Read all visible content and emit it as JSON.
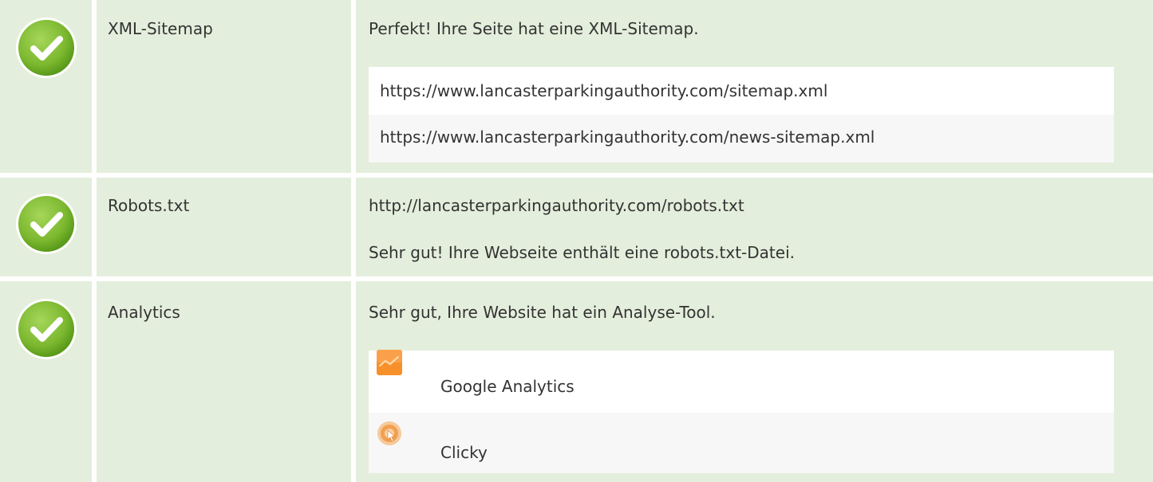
{
  "rows": [
    {
      "status": "pass",
      "label": "XML-Sitemap",
      "message": "Perfekt! Ihre Seite hat eine XML-Sitemap.",
      "urls": [
        "https://www.lancasterparkingauthority.com/sitemap.xml",
        "https://www.lancasterparkingauthority.com/news-sitemap.xml"
      ]
    },
    {
      "status": "pass",
      "label": "Robots.txt",
      "url": "http://lancasterparkingauthority.com/robots.txt",
      "message": "Sehr gut! Ihre Webseite enthält eine robots.txt-Datei."
    },
    {
      "status": "pass",
      "label": "Analytics",
      "message": "Sehr gut, Ihre Website hat ein Analyse-Tool.",
      "tools": [
        {
          "name": "Google Analytics",
          "icon": "google-analytics-icon"
        },
        {
          "name": "Clicky",
          "icon": "clicky-icon"
        }
      ]
    }
  ],
  "colors": {
    "cell_background": "#e4eedc",
    "check_green_light": "#8cc63f",
    "check_green_dark": "#5a9a1a",
    "text": "#333333",
    "list_alt_row": "#f7f7f7",
    "ga_orange": "#f7902b",
    "clicky_orange": "#f0a050"
  }
}
